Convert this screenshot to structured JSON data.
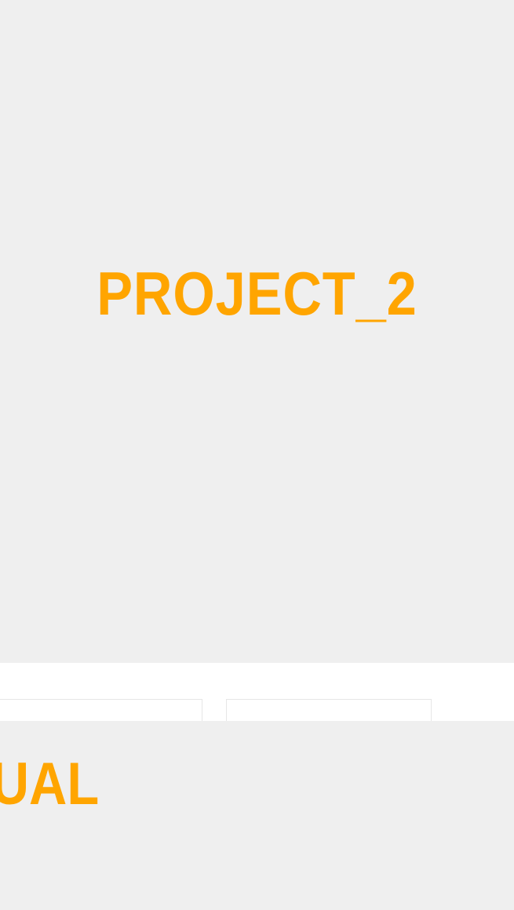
{
  "hero": {
    "title": "PROJECT_2"
  },
  "section2": {
    "title": "UAL"
  },
  "colors": {
    "accent": "#ffa500",
    "background": "#efefef",
    "band": "#ffffff"
  }
}
